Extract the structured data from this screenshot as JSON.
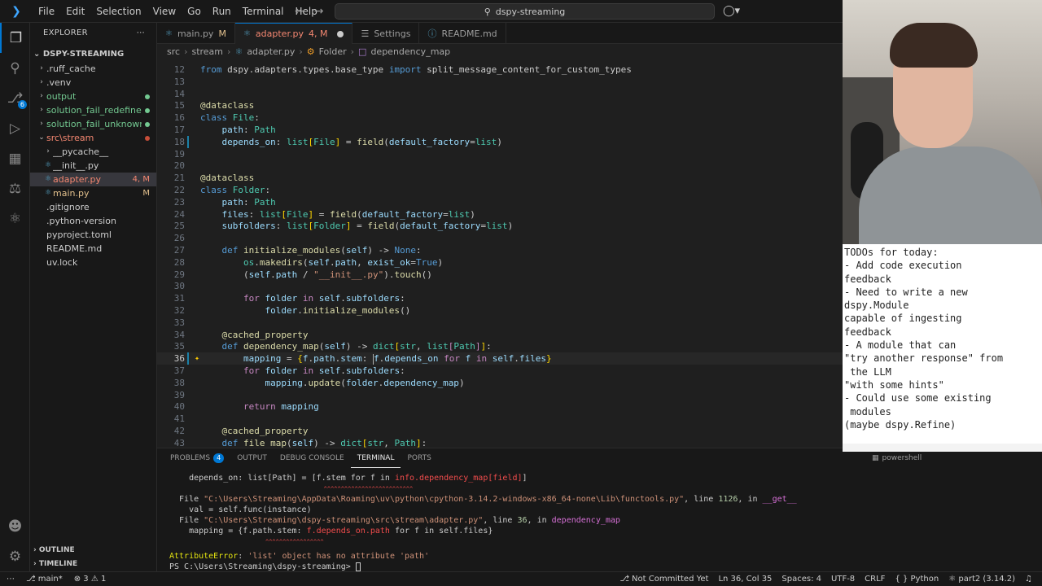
{
  "titlebar": {
    "menu": [
      "File",
      "Edit",
      "Selection",
      "View",
      "Go",
      "Run",
      "Terminal",
      "Help"
    ],
    "search_text": "dspy-streaming"
  },
  "sidebar": {
    "header": "EXPLORER",
    "root": "DSPY-STREAMING",
    "items": [
      {
        "label": ".ruff_cache",
        "type": "folder",
        "indent": 1
      },
      {
        "label": ".venv",
        "type": "folder",
        "indent": 1
      },
      {
        "label": "output",
        "type": "folder",
        "indent": 1,
        "color": "#73c991",
        "dot": "#73c991"
      },
      {
        "label": "solution_fail_redefine",
        "type": "folder",
        "indent": 1,
        "color": "#73c991",
        "dot": "#73c991"
      },
      {
        "label": "solution_fail_unknown",
        "type": "folder",
        "indent": 1,
        "color": "#73c991",
        "dot": "#73c991"
      },
      {
        "label": "src\\stream",
        "type": "folder-open",
        "indent": 1,
        "color": "#f48771",
        "dot": "#c74e39"
      },
      {
        "label": "__pycache__",
        "type": "folder",
        "indent": 2
      },
      {
        "label": "__init__.py",
        "type": "file",
        "indent": 2
      },
      {
        "label": "adapter.py",
        "type": "file",
        "indent": 2,
        "color": "#f48771",
        "deco": "4, M",
        "selected": true
      },
      {
        "label": "main.py",
        "type": "file",
        "indent": 2,
        "color": "#e2c08d",
        "deco": "M"
      },
      {
        "label": ".gitignore",
        "type": "file",
        "indent": 1
      },
      {
        "label": ".python-version",
        "type": "file",
        "indent": 1
      },
      {
        "label": "pyproject.toml",
        "type": "file",
        "indent": 1
      },
      {
        "label": "README.md",
        "type": "file",
        "indent": 1
      },
      {
        "label": "uv.lock",
        "type": "file",
        "indent": 1
      }
    ],
    "outline": "OUTLINE",
    "timeline": "TIMELINE"
  },
  "tabs": [
    {
      "label": "main.py",
      "deco": "M",
      "active": false
    },
    {
      "label": "adapter.py",
      "deco": "4, M",
      "active": true
    },
    {
      "label": "Settings",
      "deco": "",
      "active": false
    },
    {
      "label": "README.md",
      "deco": "",
      "active": false
    }
  ],
  "breadcrumb": [
    "src",
    "stream",
    "adapter.py",
    "Folder",
    "dependency_map"
  ],
  "editor": {
    "lines": [
      {
        "n": "12",
        "tokens": [
          [
            "kw",
            "from "
          ],
          [
            "pl",
            "dspy.adapters.types.base_type "
          ],
          [
            "kw",
            "import "
          ],
          [
            "pl",
            "split_message_content_for_custom_types"
          ]
        ]
      },
      {
        "n": "13",
        "tokens": []
      },
      {
        "n": "14",
        "tokens": []
      },
      {
        "n": "15",
        "tokens": [
          [
            "dec",
            "@dataclass"
          ]
        ]
      },
      {
        "n": "16",
        "tokens": [
          [
            "kw",
            "class "
          ],
          [
            "cls",
            "File"
          ],
          [
            "pl",
            ":"
          ]
        ]
      },
      {
        "n": "17",
        "tokens": [
          [
            "var",
            "    path"
          ],
          [
            "pl",
            ": "
          ],
          [
            "cls",
            "Path"
          ]
        ]
      },
      {
        "n": "18",
        "tokens": [
          [
            "var",
            "    depends_on"
          ],
          [
            "pl",
            ": "
          ],
          [
            "cls",
            "list"
          ],
          [
            "tk-br",
            "["
          ],
          [
            "cls",
            "File"
          ],
          [
            "tk-br",
            "]"
          ],
          [
            "pl",
            " = "
          ],
          [
            "fn",
            "field"
          ],
          [
            "pl",
            "("
          ],
          [
            "var",
            "default_factory"
          ],
          [
            "pl",
            "="
          ],
          [
            "cls",
            "list"
          ],
          [
            "pl",
            ")"
          ]
        ],
        "mod": true
      },
      {
        "n": "19",
        "tokens": []
      },
      {
        "n": "20",
        "tokens": []
      },
      {
        "n": "21",
        "tokens": [
          [
            "dec",
            "@dataclass"
          ]
        ]
      },
      {
        "n": "22",
        "tokens": [
          [
            "kw",
            "class "
          ],
          [
            "cls",
            "Folder"
          ],
          [
            "pl",
            ":"
          ]
        ]
      },
      {
        "n": "23",
        "tokens": [
          [
            "var",
            "    path"
          ],
          [
            "pl",
            ": "
          ],
          [
            "cls",
            "Path"
          ]
        ]
      },
      {
        "n": "24",
        "tokens": [
          [
            "var",
            "    files"
          ],
          [
            "pl",
            ": "
          ],
          [
            "cls",
            "list"
          ],
          [
            "tk-br",
            "["
          ],
          [
            "cls",
            "File"
          ],
          [
            "tk-br",
            "]"
          ],
          [
            "pl",
            " = "
          ],
          [
            "fn",
            "field"
          ],
          [
            "pl",
            "("
          ],
          [
            "var",
            "default_factory"
          ],
          [
            "pl",
            "="
          ],
          [
            "cls",
            "list"
          ],
          [
            "pl",
            ")"
          ]
        ]
      },
      {
        "n": "25",
        "tokens": [
          [
            "var",
            "    subfolders"
          ],
          [
            "pl",
            ": "
          ],
          [
            "cls",
            "list"
          ],
          [
            "tk-br",
            "["
          ],
          [
            "cls",
            "Folder"
          ],
          [
            "tk-br",
            "]"
          ],
          [
            "pl",
            " = "
          ],
          [
            "fn",
            "field"
          ],
          [
            "pl",
            "("
          ],
          [
            "var",
            "default_factory"
          ],
          [
            "pl",
            "="
          ],
          [
            "cls",
            "list"
          ],
          [
            "pl",
            ")"
          ]
        ]
      },
      {
        "n": "26",
        "tokens": []
      },
      {
        "n": "27",
        "tokens": [
          [
            "kw",
            "    def "
          ],
          [
            "fn",
            "initialize_modules"
          ],
          [
            "pl",
            "("
          ],
          [
            "var",
            "self"
          ],
          [
            "pl",
            ") -> "
          ],
          [
            "kw",
            "None"
          ],
          [
            "pl",
            ":"
          ]
        ]
      },
      {
        "n": "28",
        "tokens": [
          [
            "cls",
            "        os"
          ],
          [
            "pl",
            "."
          ],
          [
            "fn",
            "makedirs"
          ],
          [
            "pl",
            "("
          ],
          [
            "var",
            "self"
          ],
          [
            "pl",
            "."
          ],
          [
            "var",
            "path"
          ],
          [
            "pl",
            ", "
          ],
          [
            "var",
            "exist_ok"
          ],
          [
            "pl",
            "="
          ],
          [
            "kw",
            "True"
          ],
          [
            "pl",
            ")"
          ]
        ]
      },
      {
        "n": "29",
        "tokens": [
          [
            "pl",
            "        ("
          ],
          [
            "var",
            "self"
          ],
          [
            "pl",
            "."
          ],
          [
            "var",
            "path"
          ],
          [
            "pl",
            " / "
          ],
          [
            "str",
            "\"__init__.py\""
          ],
          [
            "pl",
            ")."
          ],
          [
            "fn",
            "touch"
          ],
          [
            "pl",
            "()"
          ]
        ]
      },
      {
        "n": "30",
        "tokens": []
      },
      {
        "n": "31",
        "tokens": [
          [
            "ctl",
            "        for "
          ],
          [
            "var",
            "folder"
          ],
          [
            "ctl",
            " in "
          ],
          [
            "var",
            "self"
          ],
          [
            "pl",
            "."
          ],
          [
            "var",
            "subfolders"
          ],
          [
            "pl",
            ":"
          ]
        ]
      },
      {
        "n": "32",
        "tokens": [
          [
            "var",
            "            folder"
          ],
          [
            "pl",
            "."
          ],
          [
            "fn",
            "initialize_modules"
          ],
          [
            "pl",
            "()"
          ]
        ]
      },
      {
        "n": "33",
        "tokens": []
      },
      {
        "n": "34",
        "tokens": [
          [
            "dec",
            "    @cached_property"
          ]
        ]
      },
      {
        "n": "35",
        "tokens": [
          [
            "kw",
            "    def "
          ],
          [
            "fn",
            "dependency_map"
          ],
          [
            "pl",
            "("
          ],
          [
            "var",
            "self"
          ],
          [
            "pl",
            ") -> "
          ],
          [
            "cls",
            "dict"
          ],
          [
            "tk-br",
            "["
          ],
          [
            "cls",
            "str"
          ],
          [
            "pl",
            ", "
          ],
          [
            "cls",
            "list"
          ],
          [
            "ctl",
            "["
          ],
          [
            "cls",
            "Path"
          ],
          [
            "ctl",
            "]"
          ],
          [
            "tk-br",
            "]"
          ],
          [
            "pl",
            ":"
          ]
        ]
      },
      {
        "n": "36",
        "tokens": [
          [
            "var",
            "        mapping"
          ],
          [
            "pl",
            " = "
          ],
          [
            "tk-br",
            "{"
          ],
          [
            "var",
            "f"
          ],
          [
            "pl",
            "."
          ],
          [
            "var",
            "path"
          ],
          [
            "pl",
            "."
          ],
          [
            "var",
            "stem"
          ],
          [
            "pl",
            ": "
          ],
          [
            "cursor",
            ""
          ],
          [
            "var",
            "f"
          ],
          [
            "pl",
            "."
          ],
          [
            "var",
            "depends_on"
          ],
          [
            "ctl",
            " for "
          ],
          [
            "var",
            "f"
          ],
          [
            "ctl",
            " in "
          ],
          [
            "var",
            "self"
          ],
          [
            "pl",
            "."
          ],
          [
            "var",
            "files"
          ],
          [
            "tk-br",
            "}"
          ]
        ],
        "current": true,
        "mod": true,
        "bulb": true
      },
      {
        "n": "37",
        "tokens": [
          [
            "ctl",
            "        for "
          ],
          [
            "var",
            "folder"
          ],
          [
            "ctl",
            " in "
          ],
          [
            "var",
            "self"
          ],
          [
            "pl",
            "."
          ],
          [
            "var",
            "subfolders"
          ],
          [
            "pl",
            ":"
          ]
        ]
      },
      {
        "n": "38",
        "tokens": [
          [
            "var",
            "            mapping"
          ],
          [
            "pl",
            "."
          ],
          [
            "fn",
            "update"
          ],
          [
            "pl",
            "("
          ],
          [
            "var",
            "folder"
          ],
          [
            "pl",
            "."
          ],
          [
            "var",
            "dependency_map"
          ],
          [
            "pl",
            ")"
          ]
        ]
      },
      {
        "n": "39",
        "tokens": []
      },
      {
        "n": "40",
        "tokens": [
          [
            "ctl",
            "        return "
          ],
          [
            "var",
            "mapping"
          ]
        ]
      },
      {
        "n": "41",
        "tokens": []
      },
      {
        "n": "42",
        "tokens": [
          [
            "dec",
            "    @cached_property"
          ]
        ]
      },
      {
        "n": "43",
        "tokens": [
          [
            "kw",
            "    def "
          ],
          [
            "fn",
            "file_map"
          ],
          [
            "pl",
            "("
          ],
          [
            "var",
            "self"
          ],
          [
            "pl",
            ") -> "
          ],
          [
            "cls",
            "dict"
          ],
          [
            "tk-br",
            "["
          ],
          [
            "cls",
            "str"
          ],
          [
            "pl",
            ", "
          ],
          [
            "cls",
            "Path"
          ],
          [
            "tk-br",
            "]"
          ],
          [
            "pl",
            ":"
          ]
        ]
      }
    ]
  },
  "panel": {
    "tabs": [
      "PROBLEMS",
      "OUTPUT",
      "DEBUG CONSOLE",
      "TERMINAL",
      "PORTS"
    ],
    "problems_count": "4",
    "active_tab": "TERMINAL",
    "terminal_lines": [
      {
        "segs": [
          [
            "pl",
            "    depends_on: list[Path] = [f.stem for f in "
          ],
          [
            "err",
            "info.dependency_map[field]"
          ],
          [
            "pl",
            "]"
          ]
        ]
      },
      {
        "segs": [
          [
            "caret",
            "                                             ^^^^^^^^^^^^^^^^^^^^^^^^^^"
          ]
        ]
      },
      {
        "segs": [
          [
            "pl",
            "  File "
          ],
          [
            "path",
            "\"C:\\Users\\Streaming\\AppData\\Roaming\\uv\\python\\cpython-3.14.2-windows-x86_64-none\\Lib\\functools.py\""
          ],
          [
            "pl",
            ", line "
          ],
          [
            "num",
            "1126"
          ],
          [
            "pl",
            ", in "
          ],
          [
            "fn",
            "__get__"
          ]
        ]
      },
      {
        "segs": [
          [
            "pl",
            "    val = self.func(instance)"
          ]
        ]
      },
      {
        "segs": [
          [
            "pl",
            "  File "
          ],
          [
            "path",
            "\"C:\\Users\\Streaming\\dspy-streaming\\src\\stream\\adapter.py\""
          ],
          [
            "pl",
            ", line "
          ],
          [
            "num",
            "36"
          ],
          [
            "pl",
            ", in "
          ],
          [
            "fn",
            "dependency_map"
          ]
        ]
      },
      {
        "segs": [
          [
            "pl",
            "    mapping = {f.path.stem: "
          ],
          [
            "err",
            "f.depends_on.path"
          ],
          [
            "pl",
            " for f in self.files}"
          ]
        ]
      },
      {
        "segs": [
          [
            "caret",
            "                            ^^^^^^^^^^^^^^^^^"
          ]
        ]
      },
      {
        "segs": [
          [
            "errname",
            "AttributeError"
          ],
          [
            "pl",
            ": "
          ],
          [
            "path",
            "'list' object has no attribute 'path'"
          ]
        ]
      },
      {
        "segs": [
          [
            "pl",
            "PS C:\\Users\\Streaming\\dspy-streaming> "
          ]
        ]
      }
    ]
  },
  "statusbar": {
    "branch": "main*",
    "errors": "3",
    "warnings": "1",
    "commit": "Not Committed Yet",
    "position": "Ln 36, Col 35",
    "spaces": "Spaces: 4",
    "encoding": "UTF-8",
    "eol": "CRLF",
    "language": "Python",
    "interpreter": "part2 (3.14.2)"
  },
  "notes": {
    "lines": [
      "TODOs for today:",
      "- Add code execution",
      "feedback",
      "- Need to write a new",
      "dspy.Module",
      "capable of ingesting",
      "feedback",
      "- A module that can",
      "\"try another response\" from",
      " the LLM",
      "\"with some hints\"",
      "- Could use some existing",
      " modules",
      "(maybe dspy.Refine)"
    ]
  },
  "right_terminal_label": "powershell",
  "colors": {
    "accent": "#0078d4",
    "editor_bg": "#1f1f1f",
    "sidebar_bg": "#181818"
  }
}
